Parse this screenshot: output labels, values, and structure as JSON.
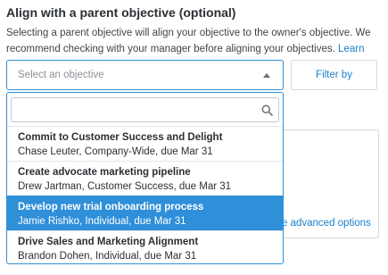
{
  "section": {
    "title": "Align with a parent objective (optional)",
    "description": "Selecting a parent objective will align your objective to the owner's objective. We recommend checking with your manager before aligning your objectives.",
    "learn_more": "Learn more"
  },
  "select": {
    "placeholder": "Select an objective",
    "caret_icon": "caret-up-icon"
  },
  "filter_button": "Filter by",
  "advanced_link": "e advanced options",
  "dropdown": {
    "search_value": "",
    "search_icon": "search-icon",
    "options": [
      {
        "title": "Commit to Customer Success and Delight",
        "subtitle": "Chase Leuter, Company-Wide, due Mar 31",
        "selected": false
      },
      {
        "title": "Create advocate marketing pipeline",
        "subtitle": "Drew Jartman, Customer Success, due Mar 31",
        "selected": false
      },
      {
        "title": "Develop new trial onboarding process",
        "subtitle": "Jamie Rishko, Individual, due Mar 31",
        "selected": true
      },
      {
        "title": "Drive Sales and Marketing Alignment",
        "subtitle": "Brandon Dohen, Individual, due Mar 31",
        "selected": false
      }
    ]
  },
  "colors": {
    "accent": "#2f8fd8",
    "link": "#1a7fc9",
    "text": "#2b2f33"
  }
}
